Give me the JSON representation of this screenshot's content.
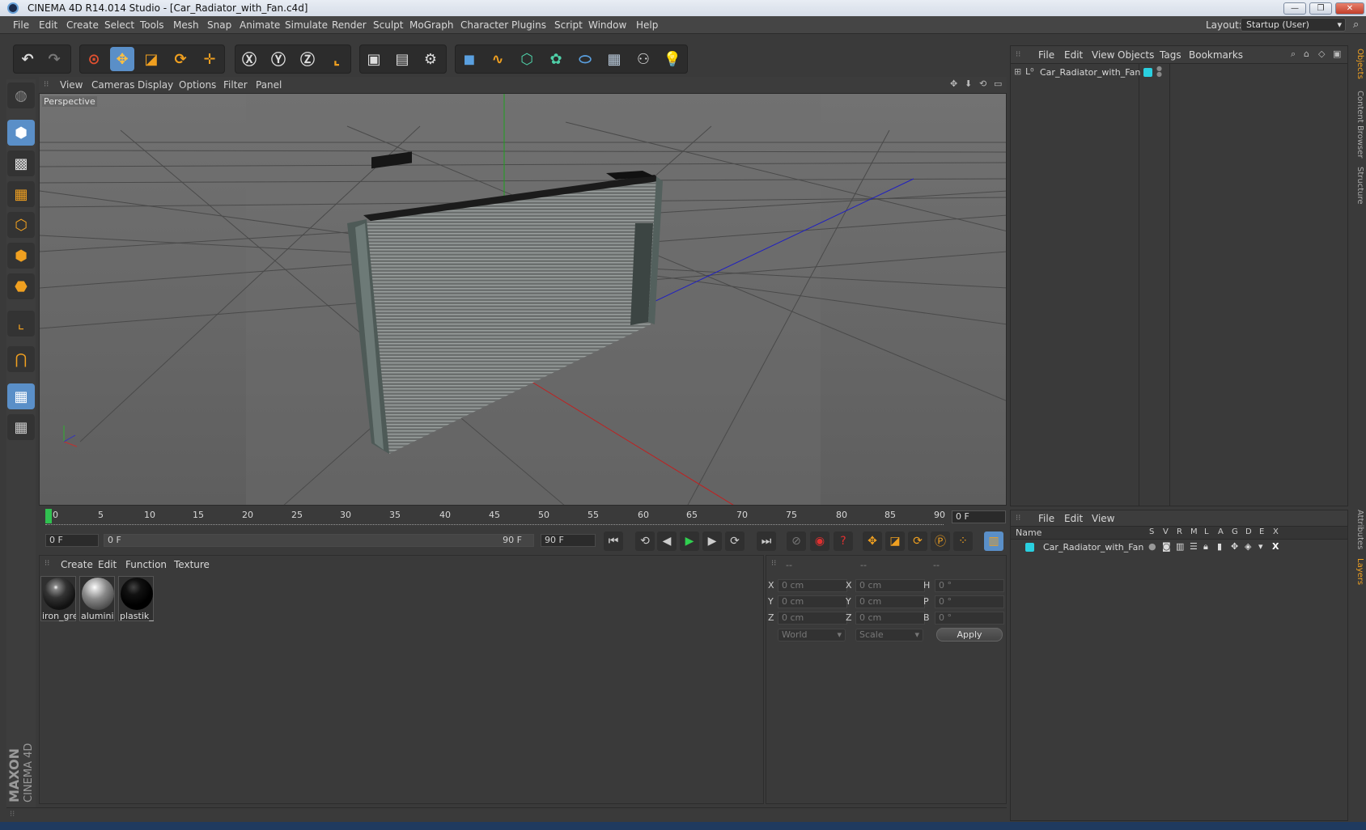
{
  "window": {
    "title": "CINEMA 4D R14.014 Studio - [Car_Radiator_with_Fan.c4d]",
    "buttons": [
      "—",
      "❐",
      "✕"
    ]
  },
  "menubar": {
    "items": [
      "File",
      "Edit",
      "Create",
      "Select",
      "Tools",
      "Mesh",
      "Snap",
      "Animate",
      "Simulate",
      "Render",
      "Sculpt",
      "MoGraph",
      "Character",
      "Plugins",
      "Script",
      "Window",
      "Help"
    ],
    "layout_label": "Layout:",
    "layout_value": "Startup (User)"
  },
  "viewport": {
    "menu": [
      "View",
      "Cameras",
      "Display",
      "Options",
      "Filter",
      "Panel"
    ],
    "label": "Perspective"
  },
  "timeline": {
    "ticks": [
      "0",
      "5",
      "10",
      "15",
      "20",
      "25",
      "30",
      "35",
      "40",
      "45",
      "50",
      "55",
      "60",
      "65",
      "70",
      "75",
      "80",
      "85",
      "90"
    ],
    "current_frame": "0 F"
  },
  "transport": {
    "start_field": "0 F",
    "range_start": "0 F",
    "range_end": "90 F",
    "end_field": "90 F"
  },
  "materials": {
    "menu": [
      "Create",
      "Edit",
      "Function",
      "Texture"
    ],
    "items": [
      {
        "name": "iron_gre",
        "color": "#505050"
      },
      {
        "name": "alumini",
        "color": "#a0a0a0"
      },
      {
        "name": "plastik_l",
        "color": "#0a0a0a"
      }
    ]
  },
  "coords": {
    "headers": [
      "--",
      "--",
      "--"
    ],
    "rows": [
      {
        "a": "X",
        "v1": "0 cm",
        "b": "X",
        "v2": "0 cm",
        "c": "H",
        "v3": "0 °"
      },
      {
        "a": "Y",
        "v1": "0 cm",
        "b": "Y",
        "v2": "0 cm",
        "c": "P",
        "v3": "0 °"
      },
      {
        "a": "Z",
        "v1": "0 cm",
        "b": "Z",
        "v2": "0 cm",
        "c": "B",
        "v3": "0 °"
      }
    ],
    "world": "World",
    "scale": "Scale",
    "apply": "Apply"
  },
  "objects": {
    "menu": [
      "File",
      "Edit",
      "View",
      "Objects",
      "Tags",
      "Bookmarks"
    ],
    "item": "Car_Radiator_with_Fan",
    "item_color": "#2ad0e0"
  },
  "layers": {
    "menu": [
      "File",
      "Edit",
      "View"
    ],
    "name_header": "Name",
    "flags": [
      "S",
      "V",
      "R",
      "M",
      "L",
      "A",
      "G",
      "D",
      "E",
      "X"
    ],
    "item": "Car_Radiator_with_Fan"
  },
  "right_tabs": [
    "Objects",
    "Content Browser",
    "Structure",
    "Attributes",
    "Layers"
  ],
  "branding": {
    "maxon": "MAXON",
    "product": "CINEMA 4D"
  }
}
